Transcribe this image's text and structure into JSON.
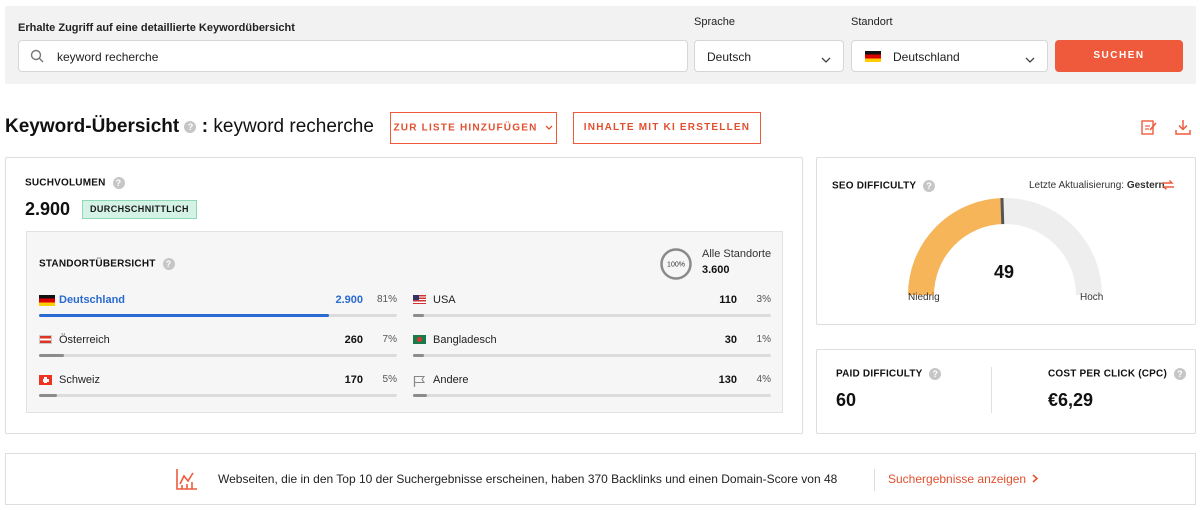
{
  "search": {
    "keyword_label": "Erhalte Zugriff auf eine detaillierte Keywordübersicht",
    "keyword_value": "keyword recherche",
    "language_label": "Sprache",
    "language_value": "Deutsch",
    "location_label": "Standort",
    "location_value": "Deutschland",
    "button_label": "SUCHEN"
  },
  "header": {
    "title": "Keyword-Übersicht",
    "separator": ":",
    "keyword": "keyword recherche",
    "add_to_list_label": "ZUR LISTE HINZUFÜGEN",
    "ai_content_label": "INHALTE MIT KI ERSTELLEN"
  },
  "volume": {
    "title": "SUCHVOLUMEN",
    "value": "2.900",
    "badge": "DURCHSCHNITTLICH"
  },
  "locations": {
    "title": "STANDORTÜBERSICHT",
    "circle_label": "100%",
    "all_label": "Alle Standorte",
    "all_value": "3.600",
    "rows": [
      {
        "name": "Deutschland",
        "value": "2.900",
        "pct": "81%",
        "share": 0.81,
        "flag": "flag-de"
      },
      {
        "name": "Österreich",
        "value": "260",
        "pct": "7%",
        "share": 0.07,
        "flag": "flag-at"
      },
      {
        "name": "Schweiz",
        "value": "170",
        "pct": "5%",
        "share": 0.05,
        "flag": "flag-ch"
      },
      {
        "name": "USA",
        "value": "110",
        "pct": "3%",
        "share": 0.03,
        "flag": "flag-us"
      },
      {
        "name": "Bangladesch",
        "value": "30",
        "pct": "1%",
        "share": 0.01,
        "flag": "flag-bd"
      },
      {
        "name": "Andere",
        "value": "130",
        "pct": "4%",
        "share": 0.04,
        "flag": "flag-outline-icon"
      }
    ]
  },
  "seo": {
    "title": "SEO DIFFICULTY",
    "updated_label": "Letzte Aktualisierung:",
    "updated_value": "Gestern",
    "score": "49",
    "score_fraction": 0.49,
    "low_label": "Niedrig",
    "high_label": "Hoch",
    "gauge_color": "#f7b55a",
    "track_color": "#eeeeee"
  },
  "paid": {
    "title": "PAID DIFFICULTY",
    "value": "60",
    "cpc_title": "COST PER CLICK (CPC)",
    "cpc_value": "€6,29"
  },
  "banner": {
    "text": "Webseiten, die in den Top 10 der Suchergebnisse erscheinen, haben 370 Backlinks und einen Domain-Score von 48",
    "link": "Suchergebnisse anzeigen"
  },
  "colors": {
    "accent": "#ef5a3c",
    "active_blue": "#2a6ad1",
    "badge_green": "#d4f3e6"
  }
}
